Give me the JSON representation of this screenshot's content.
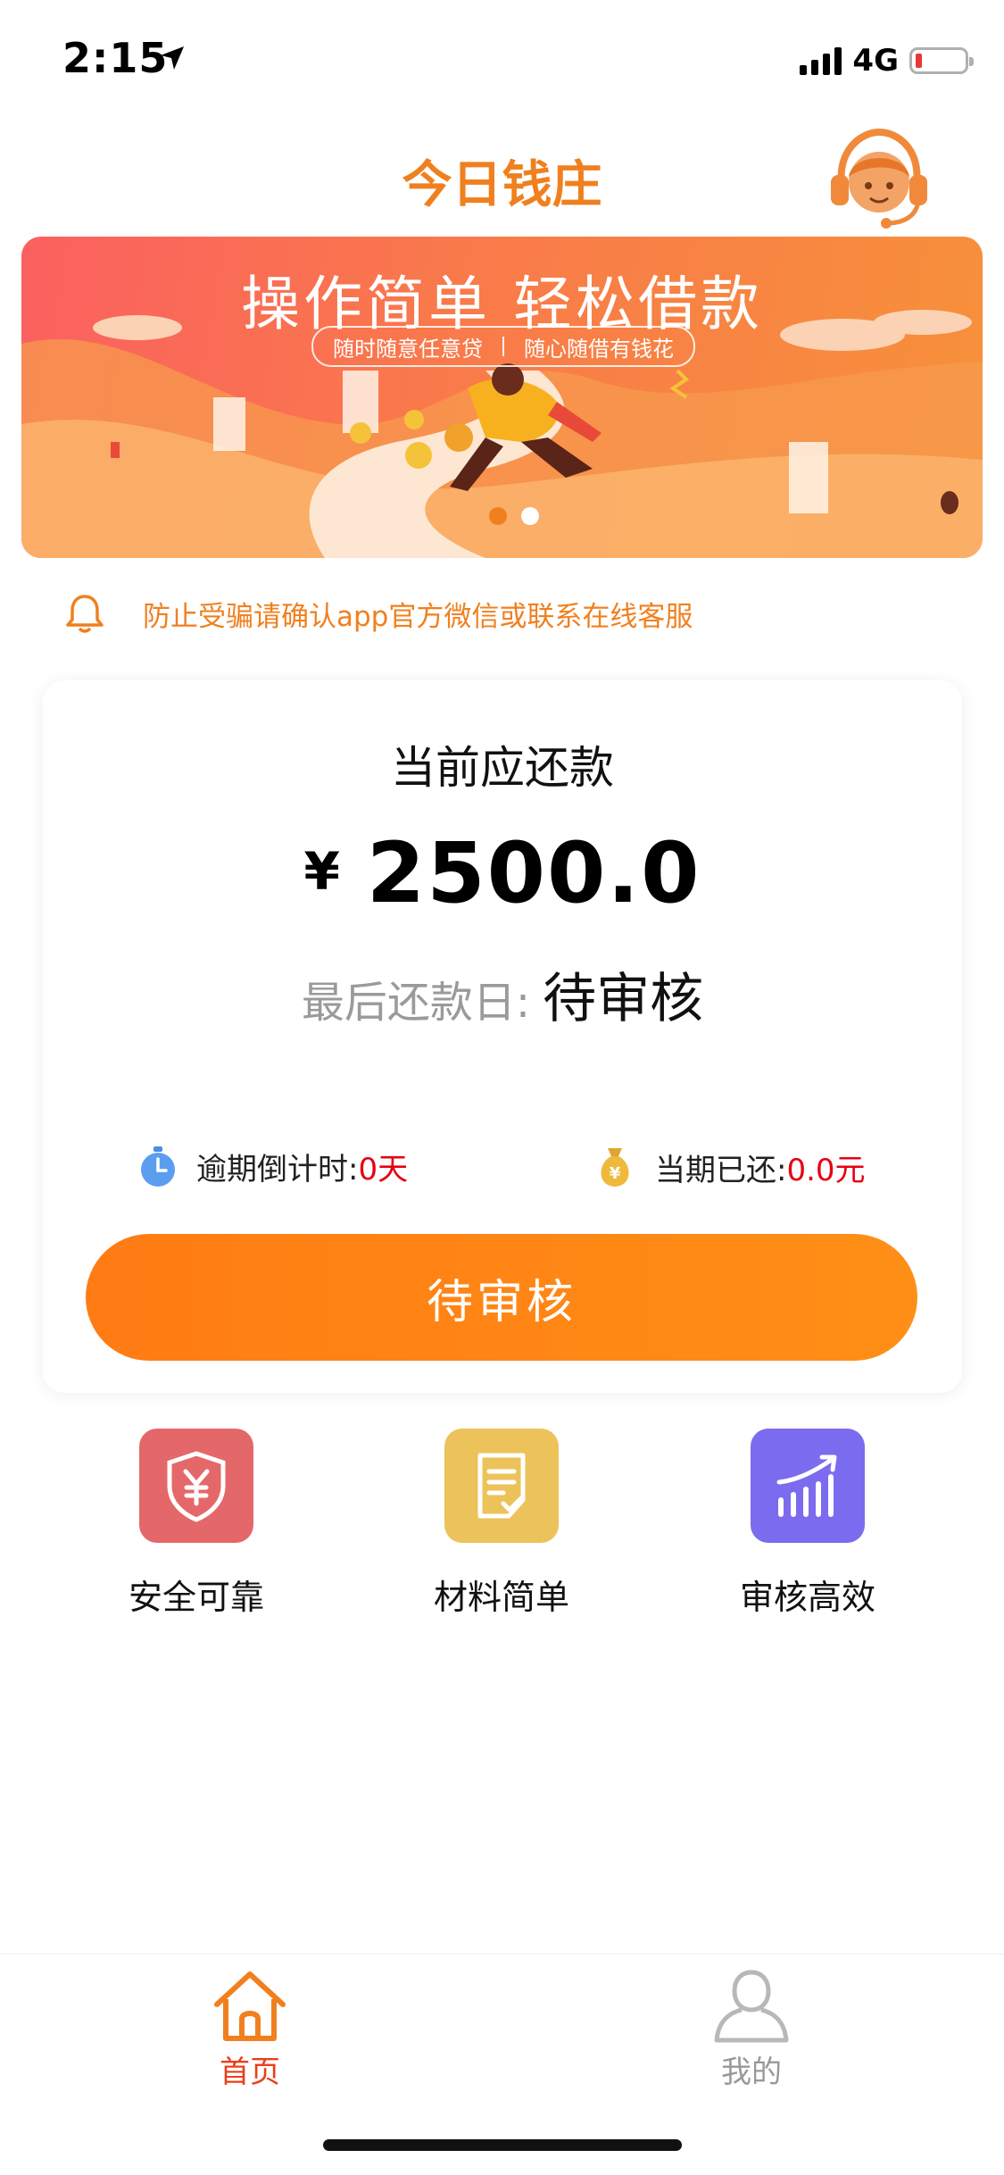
{
  "status_bar": {
    "time": "2:15",
    "network": "4G"
  },
  "header": {
    "title": "今日钱庄"
  },
  "banner": {
    "title": "操作简单  轻松借款",
    "subtitle_left": "随时随意任意贷",
    "subtitle_right": "随心随借有钱花"
  },
  "notice": {
    "text": "防止受骗请确认app官方微信或联系在线客服"
  },
  "repayment": {
    "label": "当前应还款",
    "currency": "¥",
    "amount": "2500.0",
    "due_label": "最后还款日:",
    "due_value": "待审核",
    "overdue_label": "逾期倒计时:",
    "overdue_value": "0天",
    "paid_label": "当期已还:",
    "paid_value": "0.0元",
    "button_label": "待审核"
  },
  "features": [
    {
      "label": "安全可靠",
      "color": "#e4686a"
    },
    {
      "label": "材料简单",
      "color": "#ecc25a"
    },
    {
      "label": "审核高效",
      "color": "#7b6cef"
    }
  ],
  "tabbar": {
    "tabs": [
      {
        "label": "首页",
        "active": true
      },
      {
        "label": "我的",
        "active": false
      }
    ]
  },
  "colors": {
    "accent": "#f0801f",
    "alert_red": "#e60012"
  }
}
